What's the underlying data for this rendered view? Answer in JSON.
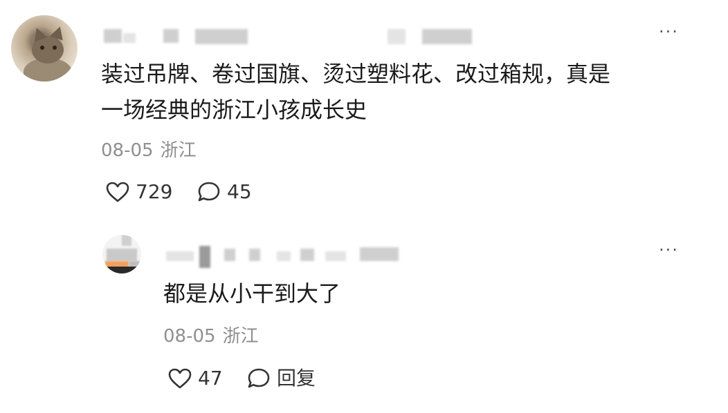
{
  "main_comment": {
    "text_line1": "装过吊牌、卷过国旗、烫过塑料花、改过箱规，真是",
    "text_line2": "一场经典的浙江小孩成长史",
    "date": "08-05",
    "location": "浙江",
    "like_count": "729",
    "reply_count": "45",
    "like_icon": "heart-outline-icon",
    "comment_icon": "speech-bubble-icon",
    "more_icon": "more-dots-icon"
  },
  "reply_comment": {
    "text": "都是从小干到大了",
    "date": "08-05",
    "location": "浙江",
    "like_count": "47",
    "reply_label": "回复",
    "like_icon": "heart-outline-icon",
    "comment_icon": "speech-bubble-icon",
    "more_icon": "more-dots-icon"
  },
  "more_glyph": "···",
  "colors": {
    "text": "#1a1a1a",
    "meta": "#8f8f8f",
    "icon": "#333333"
  }
}
